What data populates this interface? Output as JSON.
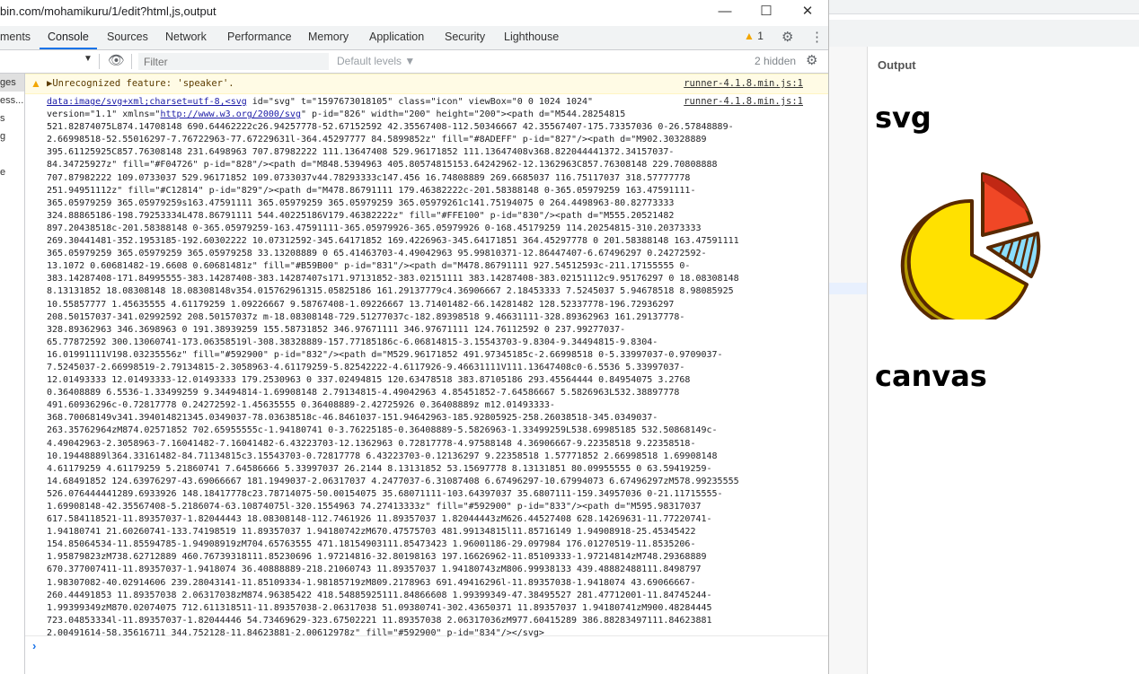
{
  "window": {
    "title": "bin.com/mohamikuru/1/edit?html,js,output",
    "controls": {
      "minimize": "—",
      "maximize": "☐",
      "close": "✕"
    }
  },
  "tabs": [
    {
      "label": "ments"
    },
    {
      "label": "Console"
    },
    {
      "label": "Sources"
    },
    {
      "label": "Network"
    },
    {
      "label": "Performance"
    },
    {
      "label": "Memory"
    },
    {
      "label": "Application"
    },
    {
      "label": "Security"
    },
    {
      "label": "Lighthouse"
    }
  ],
  "warnings_badge": {
    "icon": "warning-triangle",
    "count": "1"
  },
  "toolbar": {
    "filter_placeholder": "Filter",
    "levels_label": "Default levels ▼",
    "hidden_count": "2 hidden"
  },
  "sidebar": {
    "items": [
      "ges",
      "ess...",
      "s",
      "g",
      "",
      "e"
    ]
  },
  "console": {
    "warning": {
      "text": "▶Unrecognized feature: 'speaker'.",
      "source": "runner-4.1.8.min.js:1"
    },
    "log": {
      "source": "runner-4.1.8.min.js:1",
      "link_text": "data:image/svg+xml;charset=utf-8,<svg",
      "xmlns_link": "http://www.w3.org/2000/svg",
      "lines": [
        " id=\"svg\" t=\"1597673018105\" class=\"icon\" viewBox=\"0 0 1024 1024\"",
        "version=\"1.1\" xmlns=\"",
        "\" p-id=\"826\" width=\"200\" height=\"200\"><path d=\"M544.28254815",
        "521.82874075L874.14708148 690.64462222c26.94257778-52.67152592 42.35567408-112.50346667 42.35567407-175.73357036 0-26.57848889-",
        "2.66998518-52.55016297-7.76722963-77.67229631l-364.45297777 84.5899852z\" fill=\"#8ADEFF\" p-id=\"827\"/><path d=\"M902.30328889",
        "395.61125925C857.76308148 231.6498963 707.87982222 111.13647408 529.96171852 111.13647408v368.822044441372.34157037-",
        "84.34725927z\" fill=\"#F04726\" p-id=\"828\"/><path d=\"M848.5394963 405.80574815153.64242962-12.1362963C857.76308148 229.70808888",
        "707.87982222 109.0733037 529.96171852 109.0733037v44.78293333c147.456 16.74808889 269.6685037 116.75117037 318.57777778",
        "251.94951112z\" fill=\"#C12814\" p-id=\"829\"/><path d=\"M478.86791111 179.46382222c-201.58388148 0-365.05979259 163.47591111-",
        "365.05979259 365.05979259s163.47591111 365.05979259 365.05979259 365.05979261c141.75194075 0 264.4498963-80.82773333",
        "324.88865186-198.79253334L478.86791111 544.40225186V179.46382222z\" fill=\"#FFE100\" p-id=\"830\"/><path d=\"M555.20521482",
        "897.20438518c-201.58388148 0-365.05979259-163.47591111-365.05979926-365.05979926 0-168.45179259 114.20254815-310.20373333",
        "269.30441481-352.1953185-192.60302222 10.07312592-345.64171852 169.4226963-345.64171851 364.45297778 0 201.58388148 163.47591111",
        "365.05979259 365.05979259 365.05979258 33.13208889 0 65.41463703-4.49042963 95.99810371-12.86447407-6.67496297 0.24272592-",
        "13.1072 0.60681482-19.6608 0.60681481z\" fill=\"#B59B00\" p-id=\"831\"/><path d=\"M478.86791111 927.54512593c-211.17155555 0-",
        "383.14287408-171.84995555-383.14287408-383.14287407s171.97131852-383.02151111 383.14287408-383.02151112c9.95176297 0 18.08308148",
        "8.13131852 18.08308148 18.08308148v354.015762961315.05825186 161.29137779c4.36906667 2.18453333 7.5245037 5.94678518 8.98085925",
        "10.55857777 1.45635555 4.61179259 1.09226667 9.58767408-1.09226667 13.71401482-66.14281482 128.52337778-196.72936297",
        "208.50157037-341.02992592 208.50157037z m-18.08308148-729.51277037c-182.89398518 9.46631111-328.89362963 161.29137778-",
        "328.89362963 346.3698963 0 191.38939259 155.58731852 346.97671111 346.97671111 124.76112592 0 237.99277037-",
        "65.77872592 300.13060741-173.06358519l-308.38328889-157.77185186c-6.06814815-3.15543703-9.8304-9.34494815-9.8304-",
        "16.01991111V198.03235556z\" fill=\"#592900\" p-id=\"832\"/><path d=\"M529.96171852 491.97345185c-2.66998518 0-5.33997037-0.9709037-",
        "7.5245037-2.66998519-2.79134815-2.3058963-4.61179259-5.82542222-4.6117926-9.46631111V111.13647408c0-6.5536 5.33997037-",
        "12.01493333 12.01493333-12.01493333 179.2530963 0 337.02494815 120.63478518 383.87105186 293.45564444 0.84954075 3.2768",
        "0.36408889 6.5536-1.33499259 9.34494814-1.69908148 2.79134815-4.49042963 4.85451852-7.64586667 5.5826963L532.38897778",
        "491.60936296c-0.72817778 0.24272592-1.45635555 0.36408889-2.42725926 0.36408889z m12.01493333-",
        "368.70068149v341.394014821345.0349037-78.03638518c-46.8461037-151.94642963-185.92805925-258.26038518-345.0349037-",
        "263.35762964zM874.02571852 702.65955555c-1.94180741 0-3.76225185-0.36408889-5.5826963-1.33499259L538.69985185 532.50868149c-",
        "4.49042963-2.3058963-7.16041482-7.16041482-6.43223703-12.1362963 0.72817778-4.97588148 4.36906667-9.22358518 9.22358518-",
        "10.19448889l364.33161482-84.71134815c3.15543703-0.72817778 6.43223703-0.12136297 9.22358518 1.57771852 2.66998518 1.69908148",
        "4.61179259 4.61179259 5.21860741 7.64586666 5.33997037 26.2144 8.13131852 53.15697778 8.13131851 80.09955555 0 63.59419259-",
        "14.68491852 124.63976297-43.69066667 181.1949037-2.06317037 4.2477037-6.31087408 6.67496297-10.67994073 6.67496297zM578.99235555",
        "526.076444441289.6933926 148.18417778c23.78714075-50.00154075 35.68071111-103.64397037 35.6807111-159.34957036 0-21.11715555-",
        "1.69908148-42.35567408-5.2186074-63.10874075l-320.1554963 74.27413333z\" fill=\"#592900\" p-id=\"833\"/><path d=\"M595.98317037",
        "617.584118521-11.89357037-1.82044443 18.08308148-112.7461926 11.89357037 1.82044443zM626.44527408 628.14269631-11.77220741-",
        "1.94180741 21.60260741-133.74198519 11.89357037 1.94180742zM670.47575703 481.99134815l11.85716149 1.94908918-25.45345422",
        "154.85064534-11.85594785-1.94908919zM704.65763555 471.18154903111.85473423 1.96001186-29.097984 176.01270519-11.8535206-",
        "1.95879823zM738.62712889 460.76739318111.85230696 1.97214816-32.80198163 197.16626962-11.85109333-1.97214814zM748.29368889",
        "670.377007411-11.89357037-1.9418074 36.40888889-218.21060743 11.89357037 1.94180743zM806.99938133 439.48882488111.8498797",
        "1.98307082-40.02914606 239.28043141-11.85109334-1.98185719zM809.2178963 691.49416296l-11.89357038-1.9418074 43.69066667-",
        "260.44491853 11.89357038 2.06317038zM874.96385422 418.54885925111.84866608 1.99399349-47.38495527 281.47712001-11.84745244-",
        "1.99399349zM870.02074075 712.611318511-11.89357038-2.06317038 51.09380741-302.43650371 11.89357037 1.94180741zM900.48284445",
        "723.04853334l-11.89357037-1.82044446 54.73469629-323.67502221 11.89357038 2.06317036zM977.60415289 386.88283497111.84623881",
        "2.00491614-58.35616711 344.752128-11.84623881-2.00612978z\" fill=\"#592900\" p-id=\"834\"/></svg>"
      ]
    }
  },
  "output_pane": {
    "label": "Output",
    "heading_svg": "svg",
    "heading_canvas": "canvas"
  },
  "colors": {
    "accent": "#1a73e8",
    "pie_blue": "#8ADEFF",
    "pie_red": "#F04726",
    "pie_dark_red": "#C12814",
    "pie_yellow": "#FFE100",
    "pie_shadow": "#B59B00",
    "pie_outline": "#592900"
  }
}
